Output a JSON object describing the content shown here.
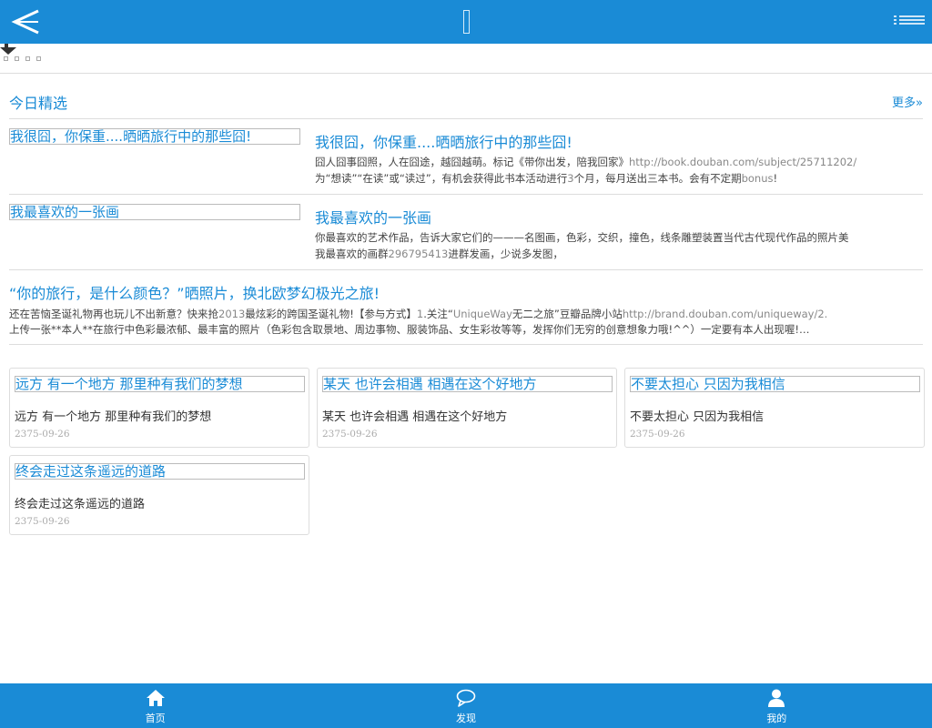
{
  "header": {
    "back_icon": "back-arrow-icon",
    "menu_icon": "list-menu-icon"
  },
  "section": {
    "title": "今日精选",
    "more": "更多»"
  },
  "features": [
    {
      "thumb_alt": "我很囧，你保重....晒晒旅行中的那些囧!",
      "title": "我很囧，你保重....晒晒旅行中的那些囧!",
      "desc_a": "囧人囧事囧照，人在囧途，越囧越萌。标记《带你出发，陪我回家》",
      "desc_link": "http://book.douban.com/subject/25711202/",
      "desc_b": "为“想读”“在读”或“读过”，有机会获得此书本活动进行",
      "desc_num": "3",
      "desc_c": "个月，每月送出三本书。会有不定期",
      "desc_bonus": "bonus",
      "desc_d": "!"
    },
    {
      "thumb_alt": "我最喜欢的一张画",
      "title": "我最喜欢的一张画",
      "desc_a": "你最喜欢的艺术作品，告诉大家它们的———名图画，色彩，交织，撞色，线条雕塑装置当代古代现代作品的照片美",
      "desc_b": "我最喜欢的画群",
      "desc_num": "296795413",
      "desc_c": "进群发画，少说多发图，"
    }
  ],
  "longpost": {
    "title": "“你的旅行，是什么颜色？”晒照片，换北欧梦幻极光之旅!",
    "line1_a": "还在苦恼圣诞礼物再也玩儿不出新意？快来抢",
    "line1_num": "2013",
    "line1_b": "最炫彩的跨国圣诞礼物!【参与方式】",
    "line1_num2": "1",
    "line1_c": ".关注“",
    "line1_brand": "UniqueWay",
    "line1_d": "无二之旅”豆瓣品牌小站",
    "line1_link": "http://brand.douban.com/uniqueway/2.",
    "line2": "上传一张**本人**在旅行中色彩最浓郁、最丰富的照片（色彩包含取景地、周边事物、服装饰品、女生彩妆等等，发挥你们无穷的创意想象力哦!^^）一定要有本人出现喔!…"
  },
  "cards": [
    {
      "title": "远方 有一个地方 那里种有我们的梦想",
      "subtitle": "远方 有一个地方 那里种有我们的梦想",
      "date": "2375-09-26"
    },
    {
      "title": "某天 也许会相遇 相遇在这个好地方",
      "subtitle": "某天 也许会相遇 相遇在这个好地方",
      "date": "2375-09-26"
    },
    {
      "title": "不要太担心 只因为我相信",
      "subtitle": "不要太担心 只因为我相信",
      "date": "2375-09-26"
    },
    {
      "title": "终会走过这条遥远的道路",
      "subtitle": "终会走过这条遥远的道路",
      "date": "2375-09-26"
    }
  ],
  "tabs": [
    {
      "label": "首页",
      "icon": "home-icon"
    },
    {
      "label": "发现",
      "icon": "chat-bubble-icon"
    },
    {
      "label": "我的",
      "icon": "user-icon"
    }
  ],
  "colors": {
    "primary": "#1a8bd6",
    "divider": "#dddddd",
    "muted": "#888888"
  }
}
